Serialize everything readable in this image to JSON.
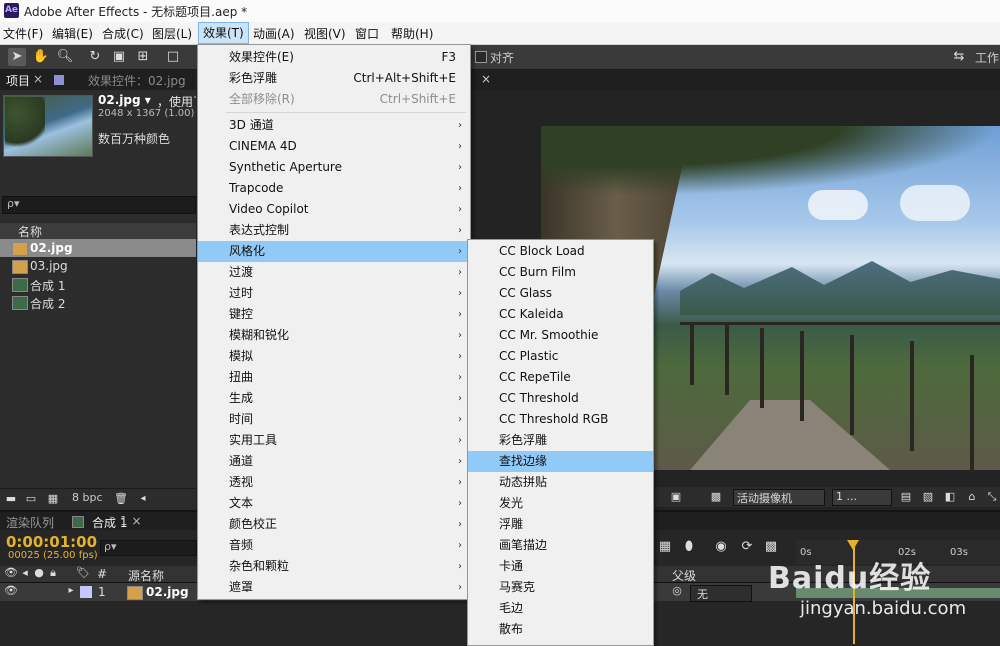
{
  "window": {
    "title": "Adobe After Effects - 无标题项目.aep *",
    "logo": "Ae"
  },
  "menubar": {
    "items": [
      "文件(F)",
      "编辑(E)",
      "合成(C)",
      "图层(L)",
      "效果(T)",
      "动画(A)",
      "视图(V)",
      "窗口",
      "帮助(H)"
    ]
  },
  "toolbar": {
    "snap_label": "对齐",
    "workspace_label": "工作"
  },
  "project": {
    "tab_project": "项目",
    "tab_effect_controls": "效果控件：02.jpg",
    "item_name": "02.jpg ▾",
    "item_used": "，使用了",
    "item_dimensions": "2048 x 1367 (1.00)",
    "item_colors": "数百万种颜色",
    "search_icon": "ρ▾",
    "column_name": "名称",
    "rows": [
      "02.jpg",
      "03.jpg",
      "合成 1",
      "合成 2"
    ],
    "bpc": "8 bpc"
  },
  "viewer": {
    "tab_close": "×",
    "camera": "活动摄像机",
    "views": "1 ..."
  },
  "timeline": {
    "tab_render": "渲染队列",
    "tab_comp": "合成 1",
    "timecode": "0:00:01:00",
    "fps": "00025 (25.00 fps)",
    "search_icon": "ρ▾",
    "col_num": "#",
    "col_source": "源名称",
    "col_parent": "父级",
    "layer_num": "1",
    "layer_name": "02.jpg",
    "parent_value": "无",
    "ruler": [
      "0s",
      "02s",
      "03s"
    ]
  },
  "effect_menu": {
    "items": [
      {
        "label": "效果控件(E)",
        "shortcut": "F3"
      },
      {
        "label": "彩色浮雕",
        "shortcut": "Ctrl+Alt+Shift+E"
      },
      {
        "label": "全部移除(R)",
        "shortcut": "Ctrl+Shift+E"
      },
      {
        "label": "3D 通道"
      },
      {
        "label": "CINEMA 4D"
      },
      {
        "label": "Synthetic Aperture"
      },
      {
        "label": "Trapcode"
      },
      {
        "label": "Video Copilot"
      },
      {
        "label": "表达式控制"
      },
      {
        "label": "风格化"
      },
      {
        "label": "过渡"
      },
      {
        "label": "过时"
      },
      {
        "label": "键控"
      },
      {
        "label": "模糊和锐化"
      },
      {
        "label": "模拟"
      },
      {
        "label": "扭曲"
      },
      {
        "label": "生成"
      },
      {
        "label": "时间"
      },
      {
        "label": "实用工具"
      },
      {
        "label": "通道"
      },
      {
        "label": "透视"
      },
      {
        "label": "文本"
      },
      {
        "label": "颜色校正"
      },
      {
        "label": "音频"
      },
      {
        "label": "杂色和颗粒"
      },
      {
        "label": "遮罩"
      }
    ]
  },
  "stylize_submenu": {
    "items": [
      "CC Block Load",
      "CC Burn Film",
      "CC Glass",
      "CC Kaleida",
      "CC Mr. Smoothie",
      "CC Plastic",
      "CC RepeTile",
      "CC Threshold",
      "CC Threshold RGB",
      "彩色浮雕",
      "查找边缘",
      "动态拼贴",
      "发光",
      "浮雕",
      "画笔描边",
      "卡通",
      "马赛克",
      "毛边",
      "散布"
    ]
  },
  "watermark": {
    "brand": "Baidu经验",
    "url": "jingyan.baidu.com"
  }
}
